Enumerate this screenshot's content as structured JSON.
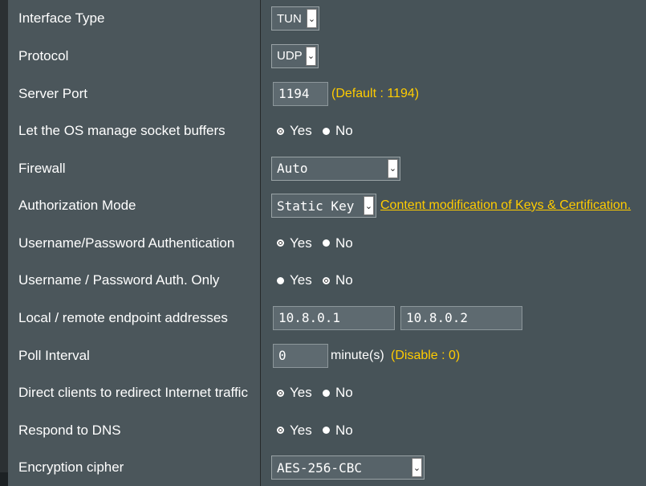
{
  "rows": [
    {
      "label": "Interface Type",
      "select_value": "TUN"
    },
    {
      "label": "Protocol",
      "select_value": "UDP"
    },
    {
      "label": "Server Port",
      "input_value": "1194",
      "hint": "(Default : 1194)"
    },
    {
      "label": "Let the OS manage socket buffers",
      "yes": "Yes",
      "no": "No",
      "selected": "Yes"
    },
    {
      "label": "Firewall",
      "select_value": "Auto"
    },
    {
      "label": "Authorization Mode",
      "select_value": "Static Key",
      "link": "Content modification of Keys & Certification."
    },
    {
      "label": "Username/Password Authentication",
      "yes": "Yes",
      "no": "No",
      "selected": "Yes"
    },
    {
      "label": "Username / Password Auth. Only",
      "yes": "Yes",
      "no": "No",
      "selected": "No"
    },
    {
      "label": "Local / remote endpoint addresses",
      "local_value": "10.8.0.1",
      "remote_value": "10.8.0.2"
    },
    {
      "label": "Poll Interval",
      "input_value": "0",
      "unit": "minute(s)",
      "hint": "(Disable : 0)"
    },
    {
      "label": "Direct clients to redirect Internet traffic",
      "yes": "Yes",
      "no": "No",
      "selected": "Yes"
    },
    {
      "label": "Respond to DNS",
      "yes": "Yes",
      "no": "No",
      "selected": "Yes"
    },
    {
      "label": "Encryption cipher",
      "select_value": "AES-256-CBC"
    }
  ],
  "colors": {
    "accent": "#ffcc00",
    "label_bg": "#4b565b",
    "field_bg": "#475358"
  },
  "icons": {
    "select_arrow": "chevron-down-icon"
  }
}
